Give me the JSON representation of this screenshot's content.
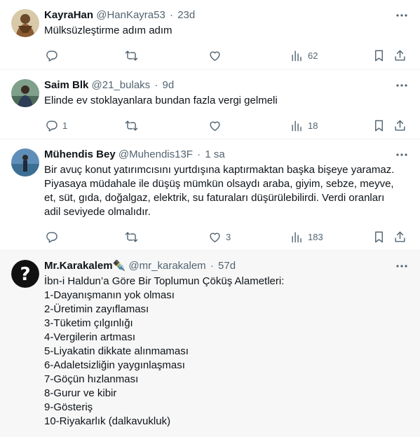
{
  "tweets": [
    {
      "name": "KayraHan",
      "handle": "@HanKayra53",
      "separator": "·",
      "time": "23d",
      "text": [
        "Mülksüzleştirme adım adım"
      ],
      "replies": "",
      "retweets": "",
      "likes": "",
      "views": "62"
    },
    {
      "name": "Saim Blk",
      "handle": "@21_bulaks",
      "separator": "·",
      "time": "9d",
      "text": [
        "Elinde ev stoklayanlara bundan fazla vergi gelmeli"
      ],
      "replies": "1",
      "retweets": "",
      "likes": "",
      "views": "18"
    },
    {
      "name": "Mühendis Bey",
      "handle": "@Muhendis13F",
      "separator": "·",
      "time": "1 sa",
      "text": [
        "Bir avuç konut yatırımcısını yurtdışına kaptırmaktan başka bişeye yaramaz.",
        "Piyasaya müdahale ile düşüş mümkün olsaydı araba, giyim, sebze, meyve,",
        "et, süt, gıda, doğalgaz, elektrik, su faturaları düşürülebilirdi. Verdi oranları",
        "adil seviyede olmalıdır."
      ],
      "replies": "",
      "retweets": "",
      "likes": "3",
      "views": "183"
    },
    {
      "name": "Mr.Karakalem✒️",
      "handle": "@mr_karakalem",
      "separator": "·",
      "time": "57d",
      "text": [
        "İbn-i Haldun’a Göre Bir Toplumun Çöküş Alametleri:",
        "1-Dayanışmanın yok olması",
        "2-Üretimin zayıflaması",
        "3-Tüketim çılgınlığı",
        "4-Vergilerin artması",
        "5-Liyakatin dikkate alınmaması",
        "6-Adaletsizliğin yaygınlaşması",
        "7-Göçün hızlanması",
        "8-Gurur ve kibir",
        "9-Gösteriş",
        "10-Riyakarlık (dalkavukluk)"
      ]
    }
  ],
  "icons": {
    "reply": "reply-icon",
    "retweet": "retweet-icon",
    "like": "heart-icon",
    "views": "views-icon",
    "bookmark": "bookmark-icon",
    "share": "share-icon",
    "more": "more-icon"
  },
  "colors": {
    "text": "#0f1419",
    "secondary": "#536471",
    "divider": "#eff3f4",
    "highlight_bg": "#f7f7f7"
  }
}
